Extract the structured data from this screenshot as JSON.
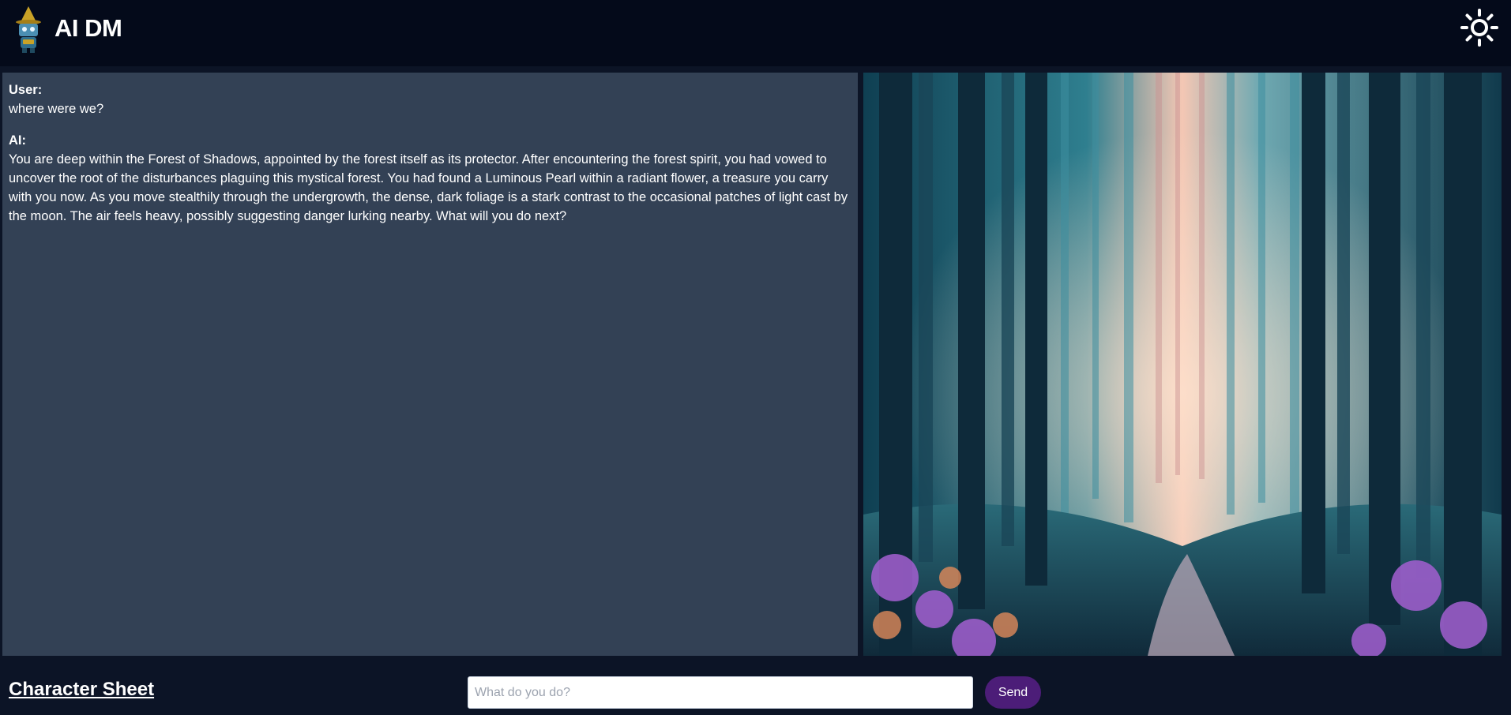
{
  "header": {
    "title": "AI DM",
    "logo_icon": "wizard-robot-icon",
    "theme_toggle_icon": "sun-icon"
  },
  "chat": {
    "messages": [
      {
        "speaker": "User:",
        "text": "where were we?"
      },
      {
        "speaker": "AI:",
        "text": "You are deep within the Forest of Shadows, appointed by the forest itself as its protector. After encountering the forest spirit, you had vowed to uncover the root of the disturbances plaguing this mystical forest. You had found a Luminous Pearl within a radiant flower, a treasure you carry with you now. As you move stealthily through the undergrowth, the dense, dark foliage is a stark contrast to the occasional patches of light cast by the moon. The air feels heavy, possibly suggesting danger lurking nearby. What will you do next?"
      }
    ]
  },
  "scene_image": {
    "subject": "forest-path-illustration"
  },
  "footer": {
    "character_sheet_label": "Character Sheet",
    "input_placeholder": "What do you do?",
    "input_value": "",
    "send_label": "Send"
  },
  "colors": {
    "page_bg": "#0c1426",
    "header_bg": "#040a1a",
    "chat_bg": "#334155",
    "send_bg": "#4c1d78"
  }
}
